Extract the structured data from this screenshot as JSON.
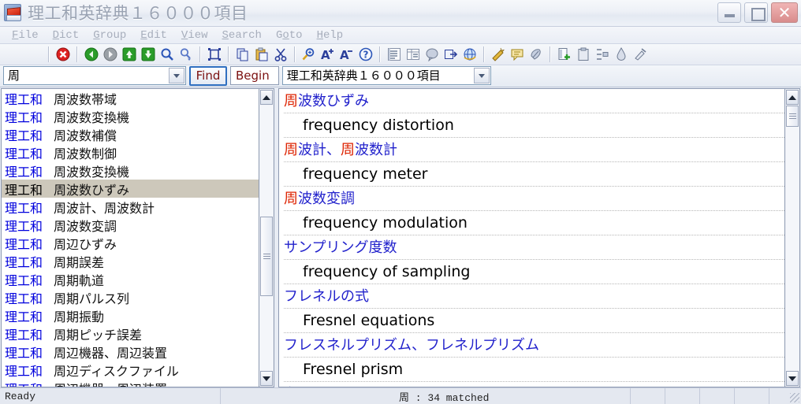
{
  "window": {
    "title": "理工和英辞典１６０００項目",
    "icon": "dictionary-book-icon",
    "controls": {
      "minimize": "–",
      "maximize": "□",
      "close": "✕"
    }
  },
  "menubar": {
    "items": [
      {
        "label": "File",
        "accel": "F"
      },
      {
        "label": "Dict",
        "accel": "D"
      },
      {
        "label": "Group",
        "accel": "G"
      },
      {
        "label": "Edit",
        "accel": "E"
      },
      {
        "label": "View",
        "accel": "V"
      },
      {
        "label": "Search",
        "accel": "S"
      },
      {
        "label": "Goto",
        "accel": "o"
      },
      {
        "label": "Help",
        "accel": "H"
      }
    ]
  },
  "toolbar": {
    "groups": [
      [
        "stop-icon"
      ],
      [
        "back-icon",
        "forward-icon",
        "up-icon",
        "down-icon",
        "search-icon",
        "search-next-icon"
      ],
      [
        "select-all-icon"
      ],
      [
        "copy-icon",
        "paste-icon",
        "cut-icon"
      ],
      [
        "zoom-icon",
        "font-increase-icon",
        "font-decrease-icon",
        "help-icon"
      ],
      [
        "list-view-icon",
        "table-view-icon",
        "balloon-icon",
        "export-icon",
        "internet-icon"
      ],
      [
        "wizard-icon",
        "comment-icon",
        "tag-icon"
      ],
      [
        "new-doc-icon",
        "clipboard-icon",
        "indent-icon",
        "ink-icon",
        "tool-icon"
      ]
    ]
  },
  "search": {
    "query": "周",
    "find_label": "Find",
    "mode": "Begin",
    "dictionary": "理工和英辞典１６０００項目"
  },
  "left_list": {
    "rows": [
      {
        "tag": "理工和",
        "term": "周波数帯域",
        "selected": false
      },
      {
        "tag": "理工和",
        "term": "周波数変換機",
        "selected": false
      },
      {
        "tag": "理工和",
        "term": "周波数補償",
        "selected": false
      },
      {
        "tag": "理工和",
        "term": "周波数制御",
        "selected": false
      },
      {
        "tag": "理工和",
        "term": "周波数変換機",
        "selected": false
      },
      {
        "tag": "理工和",
        "term": "周波数ひずみ",
        "selected": true
      },
      {
        "tag": "理工和",
        "term": "周波計、周波数計",
        "selected": false
      },
      {
        "tag": "理工和",
        "term": "周波数変調",
        "selected": false
      },
      {
        "tag": "理工和",
        "term": "周辺ひずみ",
        "selected": false
      },
      {
        "tag": "理工和",
        "term": "周期誤差",
        "selected": false
      },
      {
        "tag": "理工和",
        "term": "周期軌道",
        "selected": false
      },
      {
        "tag": "理工和",
        "term": "周期パルス列",
        "selected": false
      },
      {
        "tag": "理工和",
        "term": "周期振動",
        "selected": false
      },
      {
        "tag": "理工和",
        "term": "周期ピッチ誤差",
        "selected": false
      },
      {
        "tag": "理工和",
        "term": "周辺機器、周辺装置",
        "selected": false
      },
      {
        "tag": "理工和",
        "term": "周辺ディスクファイル",
        "selected": false
      },
      {
        "tag": "理工和",
        "term": "周辺機器、周辺装置",
        "selected": false
      }
    ]
  },
  "right_entries": {
    "lines": [
      {
        "type": "head",
        "hit": "周",
        "rest": "波数ひずみ"
      },
      {
        "type": "def",
        "text": "frequency distortion"
      },
      {
        "type": "head",
        "hit": "周",
        "rest": "波計、",
        "hit2": "周",
        "rest2": "波数計"
      },
      {
        "type": "def",
        "text": "frequency meter"
      },
      {
        "type": "head",
        "hit": "周",
        "rest": "波数変調"
      },
      {
        "type": "def",
        "text": "frequency modulation"
      },
      {
        "type": "head",
        "hit": "",
        "rest": "サンプリング度数"
      },
      {
        "type": "def",
        "text": "frequency of sampling"
      },
      {
        "type": "head",
        "hit": "",
        "rest": "フレネルの式"
      },
      {
        "type": "def",
        "text": "Fresnel equations"
      },
      {
        "type": "head",
        "hit": "",
        "rest": "フレスネルプリズム、フレネルプリズム"
      },
      {
        "type": "def",
        "text": "Fresnel prism"
      },
      {
        "type": "head",
        "hit": "",
        "rest": "糸のこ"
      }
    ]
  },
  "statusbar": {
    "ready": "Ready",
    "match": "周 : 34 matched",
    "cells": [
      "",
      "",
      "",
      "",
      ""
    ]
  },
  "colors": {
    "tag_blue": "#0000dd",
    "headword_blue": "#2222cc",
    "hit_red": "#dd2200",
    "selection": "#cdc8bb",
    "find_text": "#7b1010",
    "focus_border": "#2f6fc0"
  }
}
